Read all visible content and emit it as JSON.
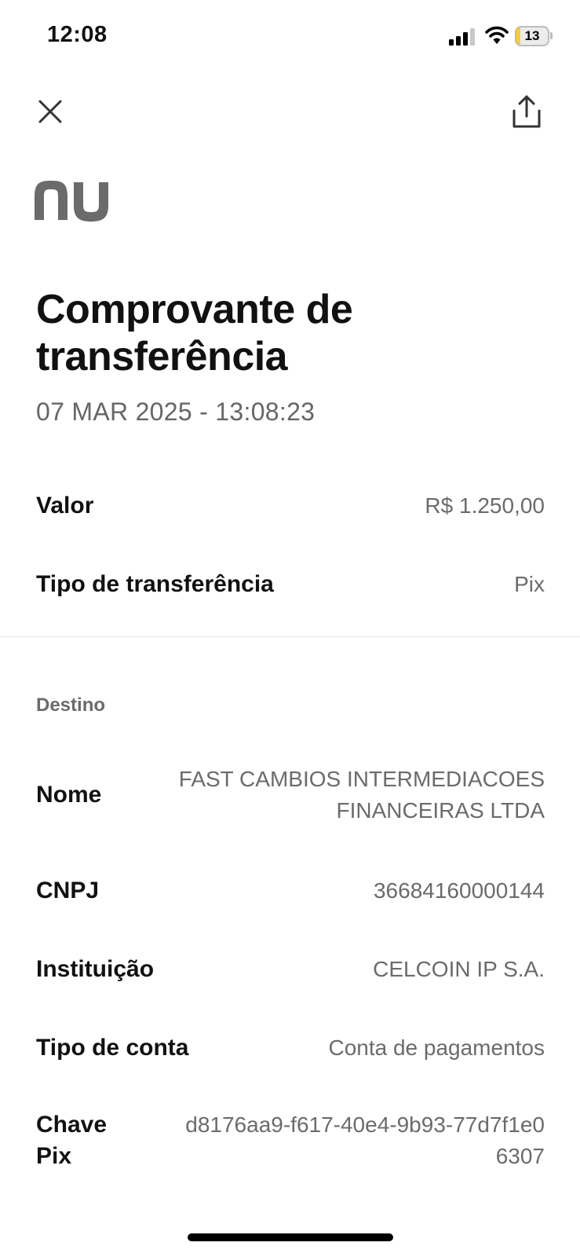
{
  "status_bar": {
    "time": "12:08",
    "battery_level": "13",
    "battery_fraction": 0.13,
    "icons": [
      "signal-icon",
      "wifi-icon",
      "battery-icon"
    ]
  },
  "header": {
    "close_icon": "close-icon",
    "share_icon": "share-icon"
  },
  "brand": {
    "logo_text": "nu",
    "logo_color": "#6b6b6b"
  },
  "receipt": {
    "title": "Comprovante de transferência",
    "datetime": "07 MAR 2025 - 13:08:23",
    "valor_label": "Valor",
    "valor": "R$ 1.250,00",
    "tipo_label": "Tipo de transferência",
    "tipo": "Pix"
  },
  "destino": {
    "section_label": "Destino",
    "nome_label": "Nome",
    "nome": "FAST CAMBIOS INTERMEDIACOES FINANCEIRAS LTDA",
    "cnpj_label": "CNPJ",
    "cnpj": "36684160000144",
    "instituicao_label": "Instituição",
    "instituicao": "CELCOIN IP S.A.",
    "conta_label": "Tipo de conta",
    "conta": "Conta de pagamentos",
    "chave_label": "Chave Pix",
    "chave": "d8176aa9-f617-40e4-9b93-77d7f1e06307"
  },
  "colors": {
    "text_primary": "#111111",
    "text_secondary": "#6b6b6b",
    "battery_fill": "#f5cf2e"
  }
}
